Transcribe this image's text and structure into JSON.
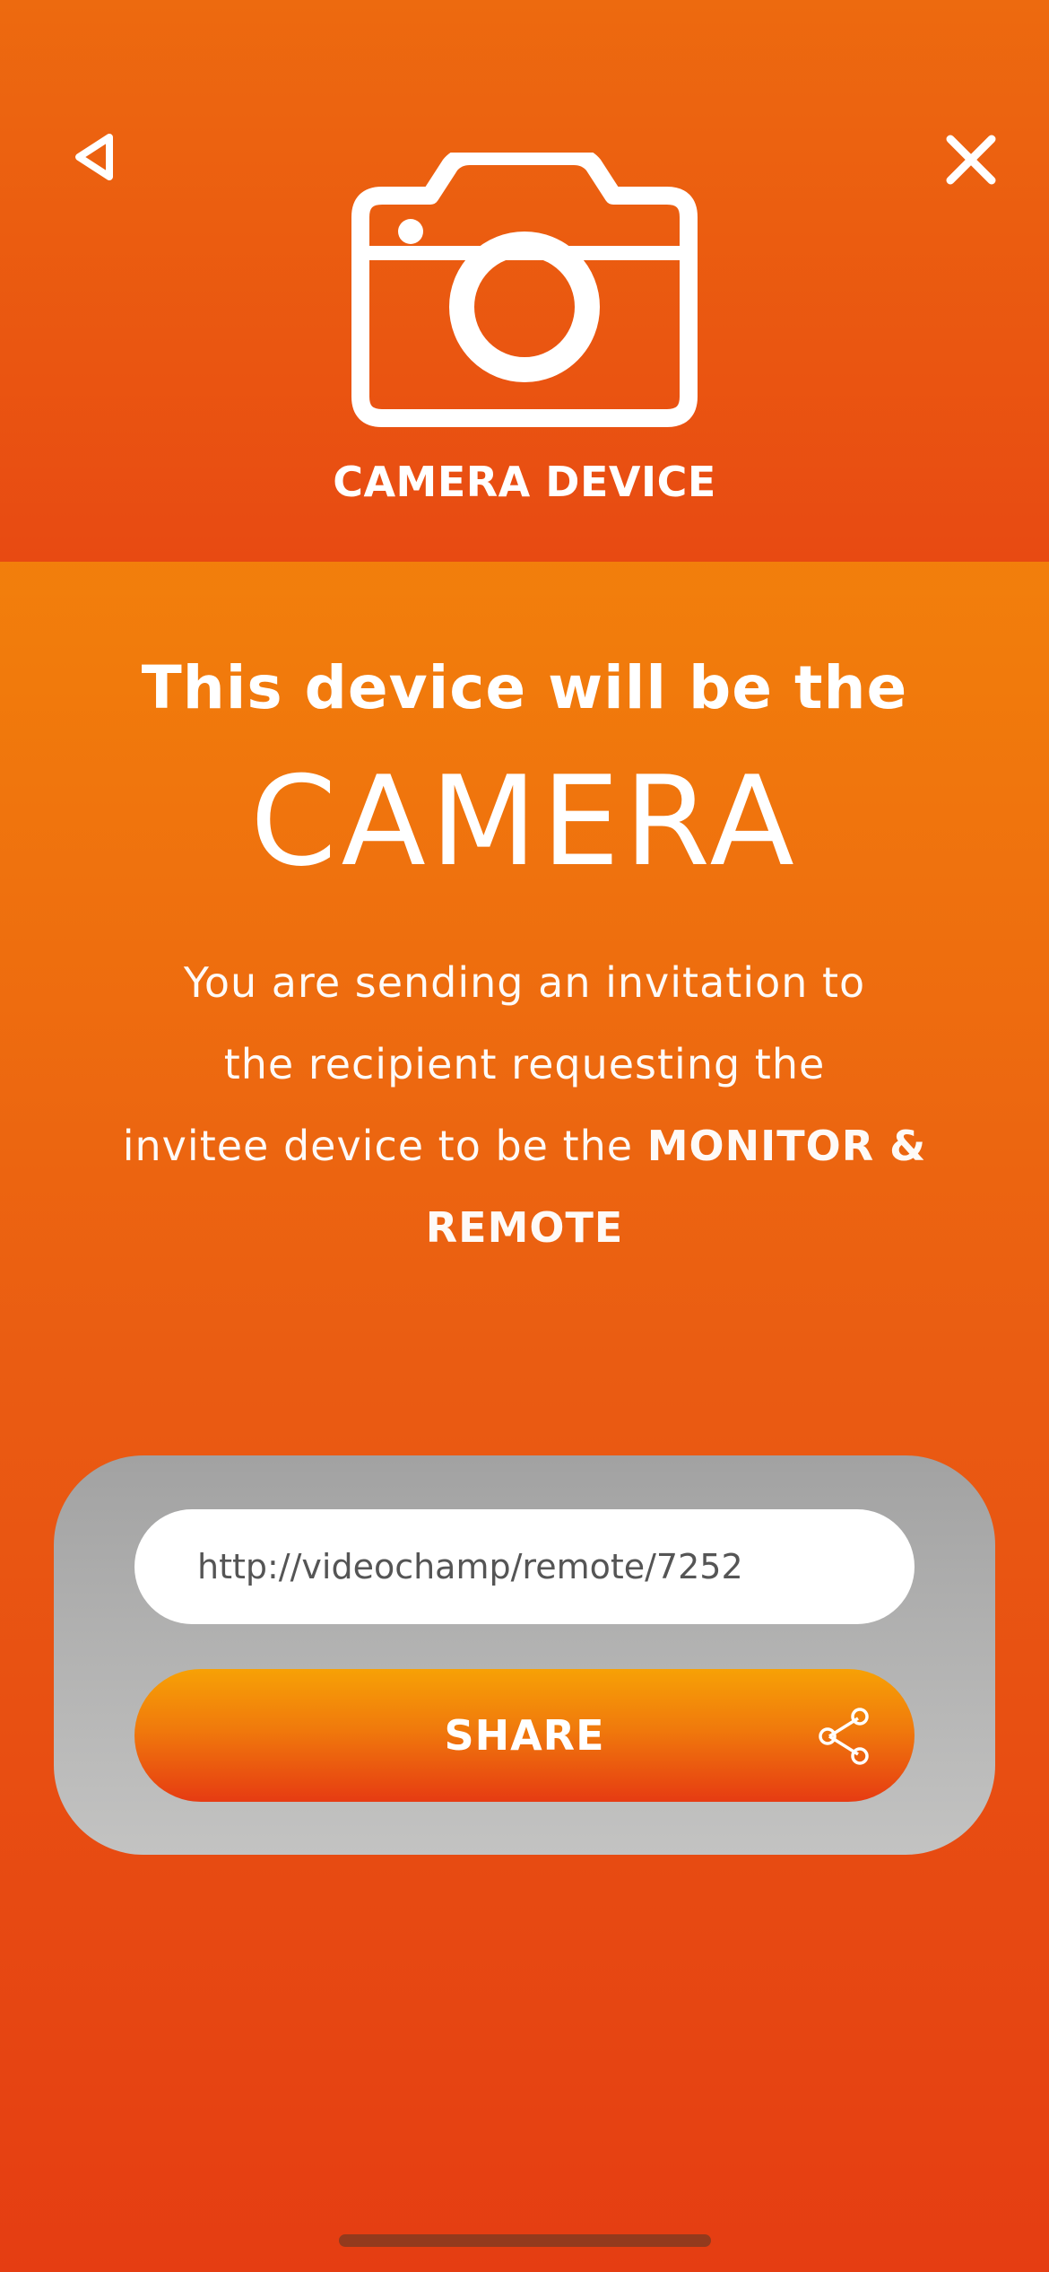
{
  "header": {
    "title": "CAMERA DEVICE",
    "back_icon": "back-triangle-icon",
    "close_icon": "close-icon",
    "hero_icon": "camera-icon"
  },
  "main": {
    "lead": "This device will be the",
    "role": "CAMERA",
    "description_line1": "You are sending an invitation to",
    "description_line2": "the recipient requesting the",
    "description_line3": "invitee device to be the",
    "description_strong": "MONITOR & REMOTE"
  },
  "share": {
    "link_value": "http://videochamp/remote/7252",
    "button_label": "SHARE",
    "button_icon": "share-icon"
  },
  "colors": {
    "accent_orange": "#f07a0c",
    "accent_red": "#e53d12",
    "card_gray": "#b2b2b2"
  }
}
